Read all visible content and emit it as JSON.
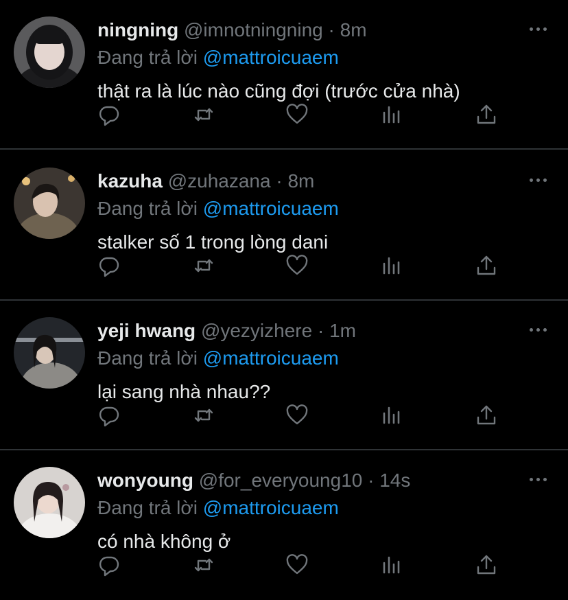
{
  "reply_prefix": "Đang trả lời",
  "colors": {
    "background": "#000000",
    "text": "#e7e9ea",
    "muted": "#71767b",
    "mention": "#1d9bf0",
    "divider": "#2f3336"
  },
  "action_icons": [
    "reply-icon",
    "retweet-icon",
    "like-icon",
    "analytics-icon",
    "share-icon"
  ],
  "tweets": [
    {
      "name": "ningning",
      "handle": "@imnotningning",
      "sep": "·",
      "time": "8m",
      "reply_to": "@mattroicuaem",
      "text": "thật ra là lúc nào cũng đợi (trước cửa nhà)"
    },
    {
      "name": "kazuha",
      "handle": "@zuhazana",
      "sep": "·",
      "time": "8m",
      "reply_to": "@mattroicuaem",
      "text": "stalker số 1 trong lòng dani"
    },
    {
      "name": "yeji hwang",
      "handle": "@yezyizhere",
      "sep": "·",
      "time": "1m",
      "reply_to": "@mattroicuaem",
      "text": "lại sang nhà nhau??"
    },
    {
      "name": "wonyoung",
      "handle": "@for_everyoung10",
      "sep": "·",
      "time": "14s",
      "reply_to": "@mattroicuaem",
      "text": "có nhà không ở"
    }
  ]
}
